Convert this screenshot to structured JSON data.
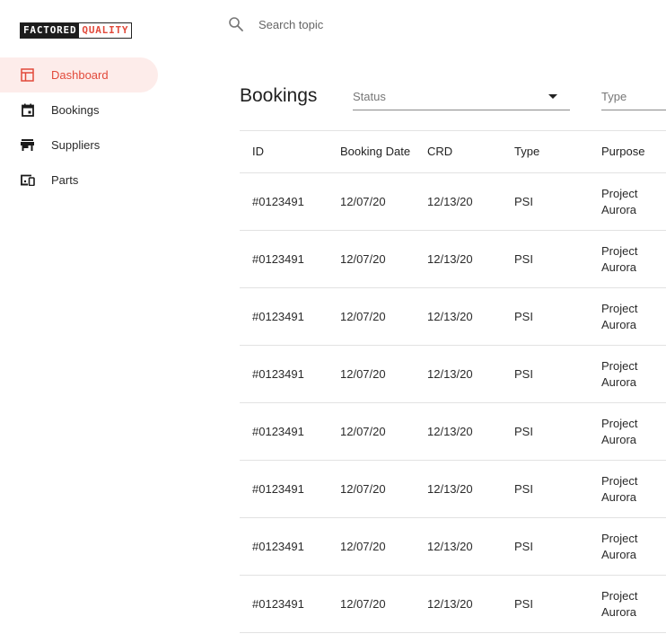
{
  "logo": {
    "part1": "FACTORED",
    "part2": "QUALITY"
  },
  "sidebar": {
    "items": [
      {
        "label": "Dashboard",
        "icon": "dashboard-icon",
        "active": true
      },
      {
        "label": "Bookings",
        "icon": "calendar-icon",
        "active": false
      },
      {
        "label": "Suppliers",
        "icon": "store-icon",
        "active": false
      },
      {
        "label": "Parts",
        "icon": "devices-icon",
        "active": false
      }
    ]
  },
  "search": {
    "placeholder": "Search topic"
  },
  "main": {
    "title": "Bookings",
    "filters": {
      "status_label": "Status",
      "type_label": "Type"
    },
    "table": {
      "columns": [
        "ID",
        "Booking Date",
        "CRD",
        "Type",
        "Purpose"
      ],
      "rows": [
        [
          "#0123491",
          "12/07/20",
          "12/13/20",
          "PSI",
          "Project Aurora"
        ],
        [
          "#0123491",
          "12/07/20",
          "12/13/20",
          "PSI",
          "Project Aurora"
        ],
        [
          "#0123491",
          "12/07/20",
          "12/13/20",
          "PSI",
          "Project Aurora"
        ],
        [
          "#0123491",
          "12/07/20",
          "12/13/20",
          "PSI",
          "Project Aurora"
        ],
        [
          "#0123491",
          "12/07/20",
          "12/13/20",
          "PSI",
          "Project Aurora"
        ],
        [
          "#0123491",
          "12/07/20",
          "12/13/20",
          "PSI",
          "Project Aurora"
        ],
        [
          "#0123491",
          "12/07/20",
          "12/13/20",
          "PSI",
          "Project Aurora"
        ],
        [
          "#0123491",
          "12/07/20",
          "12/13/20",
          "PSI",
          "Project Aurora"
        ]
      ]
    }
  },
  "colors": {
    "accent": "#e24a3b",
    "active_bg": "#fdecea",
    "divider": "#e2e2e2"
  }
}
